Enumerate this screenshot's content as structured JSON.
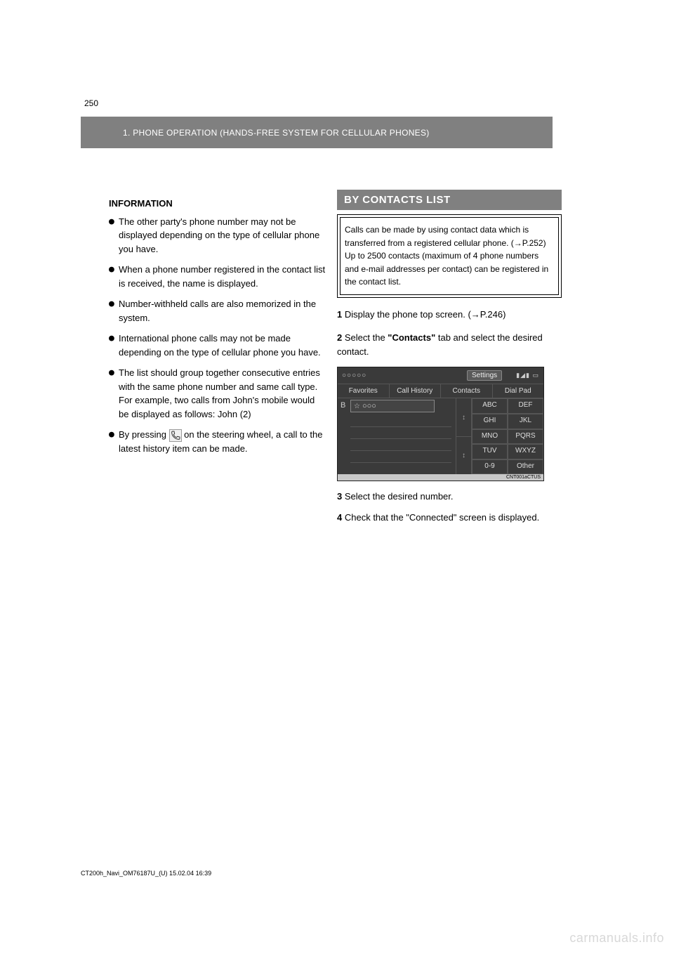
{
  "page": {
    "number": "250"
  },
  "header": {
    "breadcrumb": "1. PHONE OPERATION (HANDS-FREE SYSTEM FOR CELLULAR PHONES)"
  },
  "left": {
    "info_title": "INFORMATION",
    "bullets": [
      "The other party's phone number may not be displayed depending on the type of cellular phone you have.",
      "When a phone number registered in the contact list is received, the name is displayed.",
      "Number-withheld calls are also memorized in the system.",
      "International phone calls may not be made depending on the type of cellular phone you have.",
      "The list should group together consecutive entries with the same phone number and same call type. For example, two calls from John's mobile would be displayed as follows: John (2)"
    ],
    "icon_bullet_pre": "By pressing ",
    "icon_bullet_post": " on the steering wheel, a call to the latest history item can be made.",
    "phone_icon_name": "phone-icon"
  },
  "right": {
    "section_title": "BY CONTACTS LIST",
    "box_text": "Calls can be made by using contact data which is transferred from a registered cellular phone. (→P.252)\nUp to 2500 contacts (maximum of 4 phone numbers and e-mail addresses per contact) can be registered in the contact list.",
    "step1_num": "1",
    "step1_text": "Display the phone top screen. (→P.246)",
    "step2_num": "2",
    "step2_pre": "Select the ",
    "step2_tab": "\"Contacts\"",
    "step2_post": " tab and select the desired contact.",
    "step3_num": "3",
    "step3_text": "Select the desired number.",
    "step4_num": "4",
    "step4_text": "Check that the \"Connected\" screen is displayed.",
    "phone_shot": {
      "title_circles": "○○○○○",
      "settings": "Settings",
      "status": "▮◢▮ ▭",
      "tabs": [
        "Favorites",
        "Call History",
        "Contacts",
        "Dial Pad"
      ],
      "row_label": "B",
      "item_text": "○○○",
      "arrows": [
        "↕",
        "↕"
      ],
      "grid": [
        "ABC",
        "DEF",
        "GHI",
        "JKL",
        "MNO",
        "PQRS",
        "TUV",
        "WXYZ",
        "0-9",
        "Other"
      ],
      "code": "CNT001aCTUS"
    }
  },
  "footer": {
    "line": "CT200h_Navi_OM76187U_(U)   15.02.04   16:39"
  },
  "watermark": "carmanuals.info"
}
